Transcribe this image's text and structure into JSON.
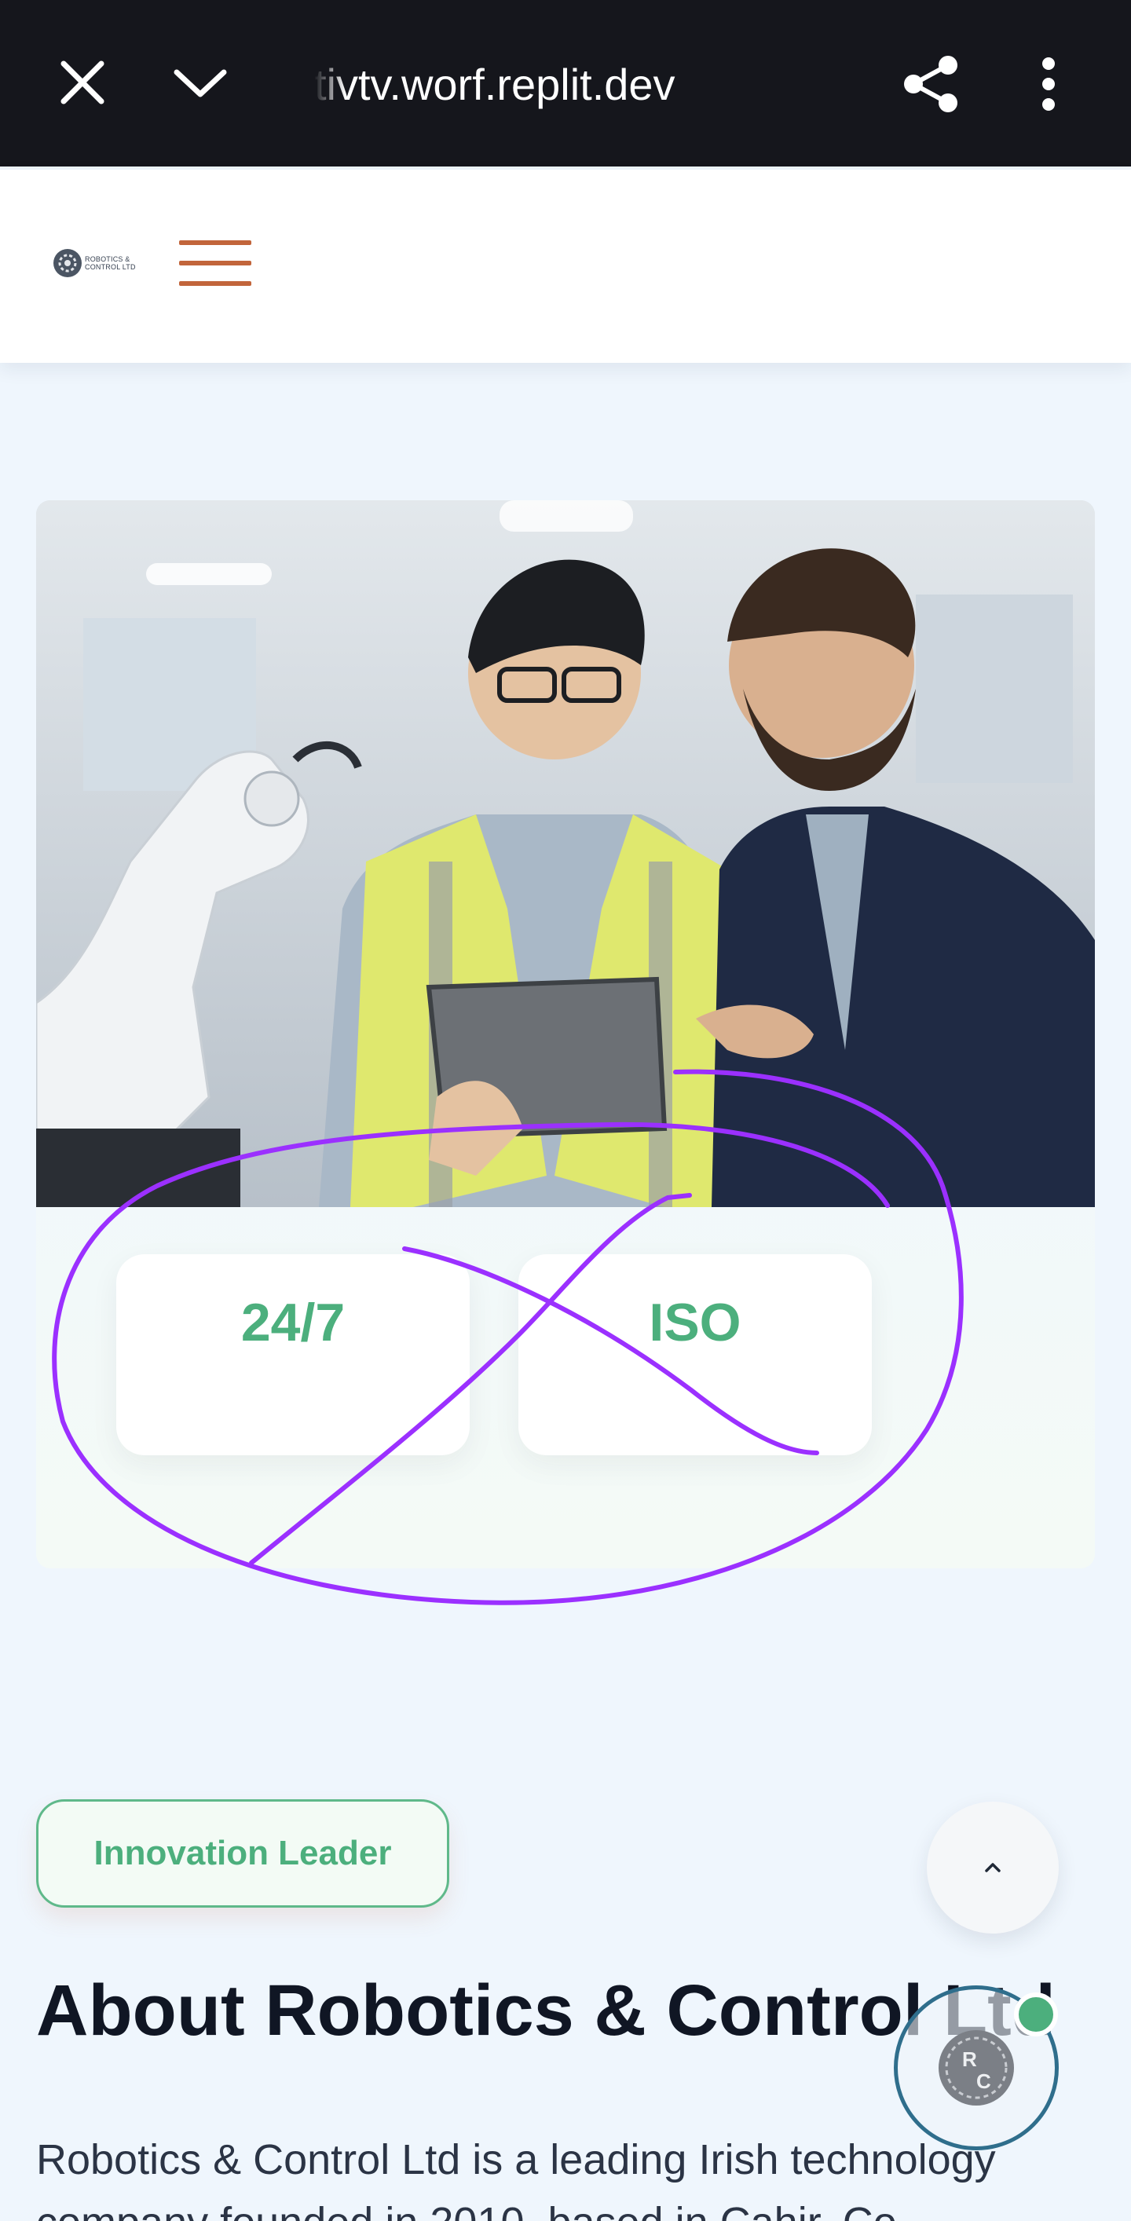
{
  "browser": {
    "url": "tivtv.worf.replit.dev",
    "icons": [
      "close-icon",
      "chevron-down-icon",
      "share-icon",
      "more-vert-icon"
    ]
  },
  "header": {
    "logo_line1": "ROBOTICS &",
    "logo_line2": "CONTROL LTD",
    "menu_icon": "hamburger-icon",
    "menu_color": "#c2653b"
  },
  "hero": {
    "image": "engineers-with-tablet-and-robot-arm",
    "stats": [
      {
        "value": "24/7"
      },
      {
        "value": "ISO"
      }
    ],
    "stat_color": "#4caf7d",
    "annotation_color": "#9b30ff"
  },
  "badge": {
    "label": "Innovation Leader"
  },
  "about": {
    "title": "About Robotics & Control Ltd",
    "text_line1": "Robotics & Control Ltd is a leading Irish technology",
    "text_line2": "company founded in 2010, based in Cahir, Co."
  },
  "floating": {
    "scroll_top_icon": "caret-up-icon",
    "chat_logo": "RC",
    "chat_status": "online"
  }
}
